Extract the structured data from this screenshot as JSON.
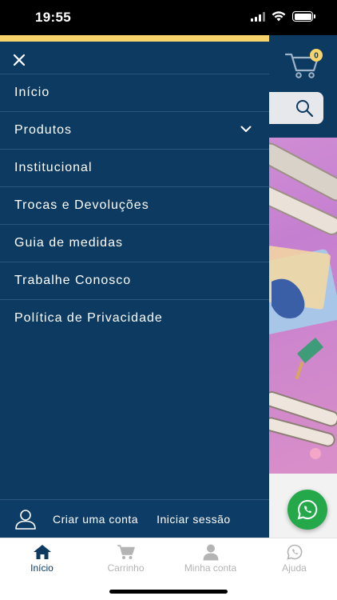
{
  "status_bar": {
    "time": "19:55"
  },
  "header": {
    "cart_count": "0"
  },
  "drawer": {
    "menu": [
      {
        "label": "Início"
      },
      {
        "label": "Produtos",
        "has_submenu": true
      },
      {
        "label": "Institucional"
      },
      {
        "label": "Trocas e Devoluções"
      },
      {
        "label": "Guia de medidas"
      },
      {
        "label": "Trabalhe Conosco"
      },
      {
        "label": "Política de Privacidade"
      }
    ],
    "footer": {
      "create_account": "Criar uma conta",
      "sign_in": "Iniciar sessão"
    }
  },
  "tabbar": {
    "tabs": [
      {
        "label": "Início",
        "icon": "home-icon",
        "active": true
      },
      {
        "label": "Carrinho",
        "icon": "cart-icon"
      },
      {
        "label": "Minha conta",
        "icon": "user-icon"
      },
      {
        "label": "Ajuda",
        "icon": "whatsapp-icon"
      }
    ]
  },
  "colors": {
    "primary": "#0c3a61",
    "accent": "#f6d36b",
    "whatsapp": "#25a84a",
    "banner": "#c57fd0"
  }
}
